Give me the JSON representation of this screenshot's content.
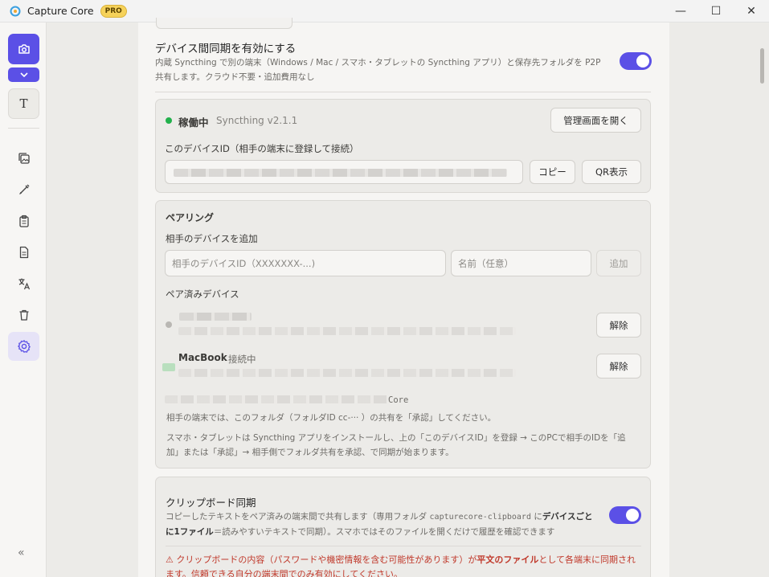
{
  "window": {
    "title": "Capture Core",
    "badge": "PRO",
    "minimize": "—",
    "maximize": "☐",
    "close": "✕"
  },
  "sidebar": {
    "text_tool": "T",
    "collapse": "«",
    "icons": [
      "camera-icon",
      "chevron-down-icon",
      "gallery-icon",
      "brush-icon",
      "clipboard-icon",
      "document-icon",
      "translate-icon",
      "trash-icon",
      "gear-icon"
    ]
  },
  "sync": {
    "title": "デバイス間同期を有効にする",
    "description": "内蔵 Syncthing で別の端末（Windows / Mac / スマホ・タブレットの Syncthing アプリ）と保存先フォルダを P2P 共有します。クラウド不要・追加費用なし",
    "enabled": true
  },
  "status": {
    "state": "稼働中",
    "version": "Syncthing v2.1.1",
    "open_admin": "管理画面を開く",
    "device_id_label": "このデバイスID（相手の端末に登録して接続）",
    "copy": "コピー",
    "qr": "QR表示"
  },
  "pairing": {
    "title": "ペアリング",
    "add_label": "相手のデバイスを追加",
    "device_id_placeholder": "相手のデバイスID（XXXXXXX-...)",
    "name_placeholder": "名前（任意）",
    "add_button": "追加",
    "paired_label": "ペア済みデバイス",
    "devices": [
      {
        "name": "",
        "status": "",
        "unpair": "解除"
      },
      {
        "name": "MacBook",
        "status": "接続中",
        "unpair": "解除"
      }
    ],
    "folder_suffix": "Core",
    "note1": "相手の端末では、このフォルダ（フォルダID cc-··· ）の共有を「承認」してください。",
    "note2": "スマホ・タブレットは Syncthing アプリをインストールし、上の「このデバイスID」を登録 → このPCで相手のIDを「追加」または「承認」→ 相手側でフォルダ共有を承認、で同期が始まります。"
  },
  "clipboard": {
    "title": "クリップボード同期",
    "description_a": "コピーしたテキストをペア済みの端末間で共有します（専用フォルダ",
    "folder_name": "capturecore-clipboard",
    "description_b": "に",
    "description_bold": "デバイスごとに1ファイル",
    "description_c": "＝読みやすいテキストで同期）。スマホではそのファイルを開くだけで履歴を確認できます",
    "enabled": true,
    "warning_a": "⚠ クリップボードの内容（パスワードや機密情報を含む可能性があります）が",
    "warning_bold": "平文のファイル",
    "warning_b": "として各端末に同期されます。信頼できる自分の端末間でのみ有効にしてください。"
  },
  "colors": {
    "accent": "#5b50e6",
    "status_green": "#22b14c",
    "warning_red": "#c0392b",
    "pro_badge": "#f6d25a"
  }
}
